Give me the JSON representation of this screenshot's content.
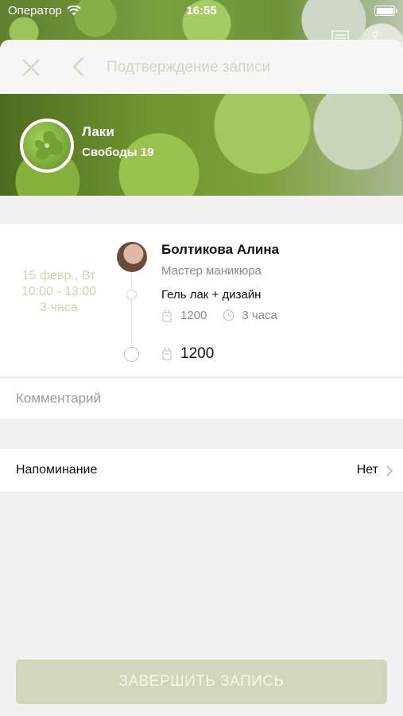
{
  "status_bar": {
    "carrier": "Оператор",
    "time": "16:55"
  },
  "nav": {
    "title": "Подтверждение записи"
  },
  "salon": {
    "name": "Лаки",
    "address": "Свободы 19"
  },
  "appointment": {
    "date": "15 февр., Вт",
    "time_range": "10:00 - 13:00",
    "duration": "3 часа",
    "master_name": "Болтикова Алина",
    "master_role": "Мастер маникюра",
    "service_name": "Гель лак + дизайн",
    "service_price": "1200",
    "service_duration": "3 часа",
    "total": "1200"
  },
  "comment": {
    "placeholder": "Комментарий"
  },
  "reminder": {
    "label": "Напоминание",
    "value": "Нет"
  },
  "finish_button": {
    "label": "ЗАВЕРШИТЬ ЗАПИСЬ"
  },
  "colors": {
    "accent": "#d2d6ba",
    "accent_text": "#d1d3b2",
    "sheet_bg": "#f1f1f1"
  }
}
